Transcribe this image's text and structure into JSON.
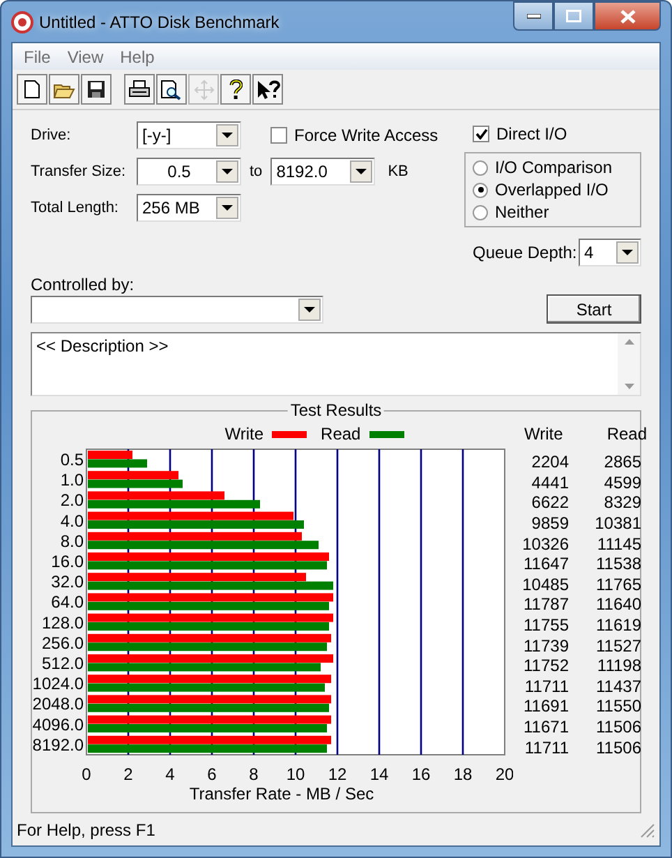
{
  "window": {
    "title": "Untitled - ATTO Disk Benchmark"
  },
  "menu": [
    "File",
    "View",
    "Help"
  ],
  "toolbar": [
    {
      "kind": "new",
      "disabled": false
    },
    {
      "kind": "open",
      "disabled": false
    },
    {
      "kind": "save",
      "disabled": false
    },
    {
      "kind": "print",
      "disabled": false
    },
    {
      "kind": "preview",
      "disabled": false
    },
    {
      "kind": "move",
      "disabled": true
    },
    {
      "kind": "help",
      "disabled": false
    },
    {
      "kind": "context_help",
      "disabled": false
    }
  ],
  "form": {
    "drive": {
      "label": "Drive:",
      "value": "[-y-]"
    },
    "force_write_access": {
      "label": "Force Write Access",
      "checked": false
    },
    "direct_io": {
      "label": "Direct I/O",
      "checked": true
    },
    "transfer_size": {
      "label": "Transfer Size:",
      "from": "0.5",
      "to_label": "to",
      "to": "8192.0",
      "unit": "KB"
    },
    "total_length": {
      "label": "Total Length:",
      "value": "256 MB"
    },
    "io_modes": [
      {
        "label": "I/O Comparison",
        "selected": false
      },
      {
        "label": "Overlapped I/O",
        "selected": true
      },
      {
        "label": "Neither",
        "selected": false
      }
    ],
    "queue_depth": {
      "label": "Queue Depth:",
      "value": "4"
    },
    "controlled_by": {
      "label": "Controlled by:"
    },
    "start_button": "Start",
    "description": "<< Description >>"
  },
  "test_results": {
    "title": "Test Results",
    "columns": [
      "Write",
      "Read"
    ],
    "rows": [
      {
        "write": "2204",
        "read": "2865"
      },
      {
        "write": "4441",
        "read": "4599"
      },
      {
        "write": "6622",
        "read": "8329"
      },
      {
        "write": "9859",
        "read": "10381"
      },
      {
        "write": "10326",
        "read": "11145"
      },
      {
        "write": "11647",
        "read": "11538"
      },
      {
        "write": "10485",
        "read": "11765"
      },
      {
        "write": "11787",
        "read": "11640"
      },
      {
        "write": "11755",
        "read": "11619"
      },
      {
        "write": "11739",
        "read": "11527"
      },
      {
        "write": "11752",
        "read": "11198"
      },
      {
        "write": "11711",
        "read": "11437"
      },
      {
        "write": "11691",
        "read": "11550"
      },
      {
        "write": "11671",
        "read": "11506"
      },
      {
        "write": "11711",
        "read": "11506"
      }
    ],
    "chart_data": {
      "type": "bar",
      "orientation": "horizontal",
      "xlabel": "Transfer Rate - MB / Sec",
      "categories": [
        "0.5",
        "1.0",
        "2.0",
        "4.0",
        "8.0",
        "16.0",
        "32.0",
        "64.0",
        "128.0",
        "256.0",
        "512.0",
        "1024.0",
        "2048.0",
        "4096.0",
        "8192.0"
      ],
      "series": [
        {
          "name": "Write",
          "color": "#ff0000",
          "values": [
            2.2,
            4.4,
            6.6,
            9.9,
            10.3,
            11.6,
            10.5,
            11.8,
            11.8,
            11.7,
            11.8,
            11.7,
            11.7,
            11.7,
            11.7
          ]
        },
        {
          "name": "Read",
          "color": "#008000",
          "values": [
            2.9,
            4.6,
            8.3,
            10.4,
            11.1,
            11.5,
            11.8,
            11.6,
            11.6,
            11.5,
            11.2,
            11.4,
            11.6,
            11.5,
            11.5
          ]
        }
      ],
      "grid": true,
      "xlim": [
        0,
        20
      ],
      "xticks": [
        0,
        2,
        4,
        6,
        8,
        10,
        12,
        14,
        16,
        18,
        20
      ]
    }
  },
  "status_bar": "For Help, press F1"
}
